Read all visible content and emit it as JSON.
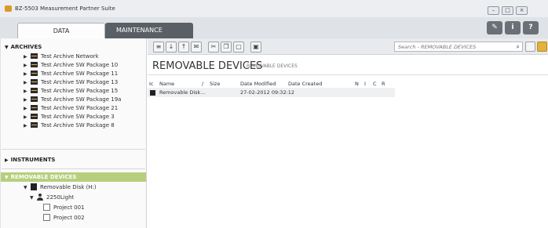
{
  "window": {
    "title": "BZ-5503 Measurement Partner Suite",
    "controls": [
      "minimize-icon",
      "maximize-icon",
      "close-icon"
    ]
  },
  "tabs": [
    {
      "label": "DATA",
      "active": true
    },
    {
      "label": "MAINTENANCE",
      "active": false
    }
  ],
  "top_tools": [
    "wrench-icon",
    "info-icon",
    "help-icon"
  ],
  "sidebar": {
    "archives": {
      "label": "ARCHIVES",
      "items": [
        {
          "label": "Test Archive Network"
        },
        {
          "label": "Test Archive SW Package 10"
        },
        {
          "label": "Test Archive SW Package 11"
        },
        {
          "label": "Test Archive SW Package 13"
        },
        {
          "label": "Test Archive SW Package 15"
        },
        {
          "label": "Test Archive SW Package 19a"
        },
        {
          "label": "Test Archive SW Package 21"
        },
        {
          "label": "Test Archive SW Package 3"
        },
        {
          "label": "Test Archive SW Package 8"
        }
      ]
    },
    "instruments": {
      "label": "INSTRUMENTS"
    },
    "removable": {
      "label": "REMOVABLE DEVICES",
      "disk": "Removable Disk (H:)",
      "user": "2250Light",
      "projects": [
        "Project 001",
        "Project 002"
      ]
    }
  },
  "toolbar": {
    "icons": [
      "compare-icon",
      "download-icon",
      "upload-icon",
      "mail-icon",
      "cut-icon",
      "copy-icon",
      "paste-icon",
      "new-folder-icon"
    ],
    "search_placeholder": "Search - REMOVABLE DEVICES"
  },
  "main": {
    "title": "REMOVABLE DEVICES",
    "breadcrumb": "REMOVABLE DEVICES",
    "columns": [
      "Ic",
      "Name",
      "/",
      "Size",
      "Date Modified",
      "Date Created",
      "N",
      "I",
      "C",
      "R"
    ],
    "rows": [
      {
        "name": "Removable Disk...",
        "size": "",
        "date_modified": "27-02-2012 09:32:12",
        "date_created": ""
      }
    ]
  }
}
